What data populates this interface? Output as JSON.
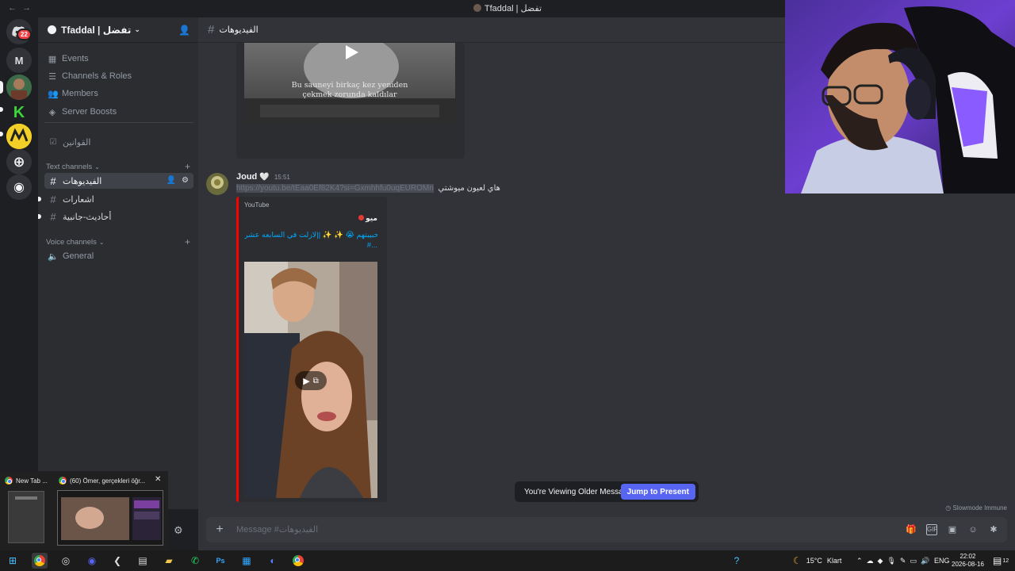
{
  "window": {
    "title": "Tfaddal | تفضل",
    "back_glyph": "←",
    "forward_glyph": "→"
  },
  "rail": {
    "dm_badge": "22",
    "letter_server": "M",
    "k_server": "K"
  },
  "server": {
    "name": "Tfaddal | تفضل",
    "nav": [
      {
        "label": "Events",
        "icon": "calendar-icon"
      },
      {
        "label": "Channels & Roles",
        "icon": "list-icon"
      },
      {
        "label": "Members",
        "icon": "members-icon"
      },
      {
        "label": "Server Boosts",
        "icon": "boost-icon"
      }
    ],
    "rules_channel": "القوانين",
    "text_category": "Text channels",
    "text_channels": [
      "الفيديوهات",
      "اشعارات",
      "أحاديث-جانبية"
    ],
    "voice_category": "Voice channels",
    "voice_channels": [
      "General"
    ]
  },
  "channel": {
    "name": "الفيديوهات"
  },
  "messages": {
    "top_video_caption_line1": "Bu sauneyi birkaç kez yeniden",
    "top_video_caption_line2": "çekmek zorunda kaldılar",
    "author": "Joud",
    "author_heart": "🤍",
    "time": "15:51",
    "link": "https://youtu.be/tEaa0Ef82K4?si=Gxmhhfu0uqEUROMn",
    "text": "هاي لعيون ميوشتي",
    "embed": {
      "provider": "YouTube",
      "channel_name": "ميو",
      "title_line1": "حبيبتهم 😭 ✨ ✨ ||لازلت في السابعه عشر",
      "title_line2": "#..."
    }
  },
  "jump": {
    "notice": "You're Viewing Older Messages",
    "button": "Jump to Present"
  },
  "slowmode": "Slowmode Immune",
  "composer": {
    "placeholder": "Message #الفيديوهات"
  },
  "taskbar_popup": {
    "tab1": "New Tab ...",
    "tab2": "(60) Ömer, gerçekleri öğr...",
    "close": "✕"
  },
  "tray": {
    "temp": "15°C",
    "weather": "Klart",
    "lang": "ENG",
    "time": "22:02",
    "date": "2026-08-16",
    "notif_count": "12"
  },
  "colors": {
    "accent": "#5865f2",
    "embed_border": "#ff0000",
    "link": "#00a8fc",
    "badge": "#f23f43"
  }
}
